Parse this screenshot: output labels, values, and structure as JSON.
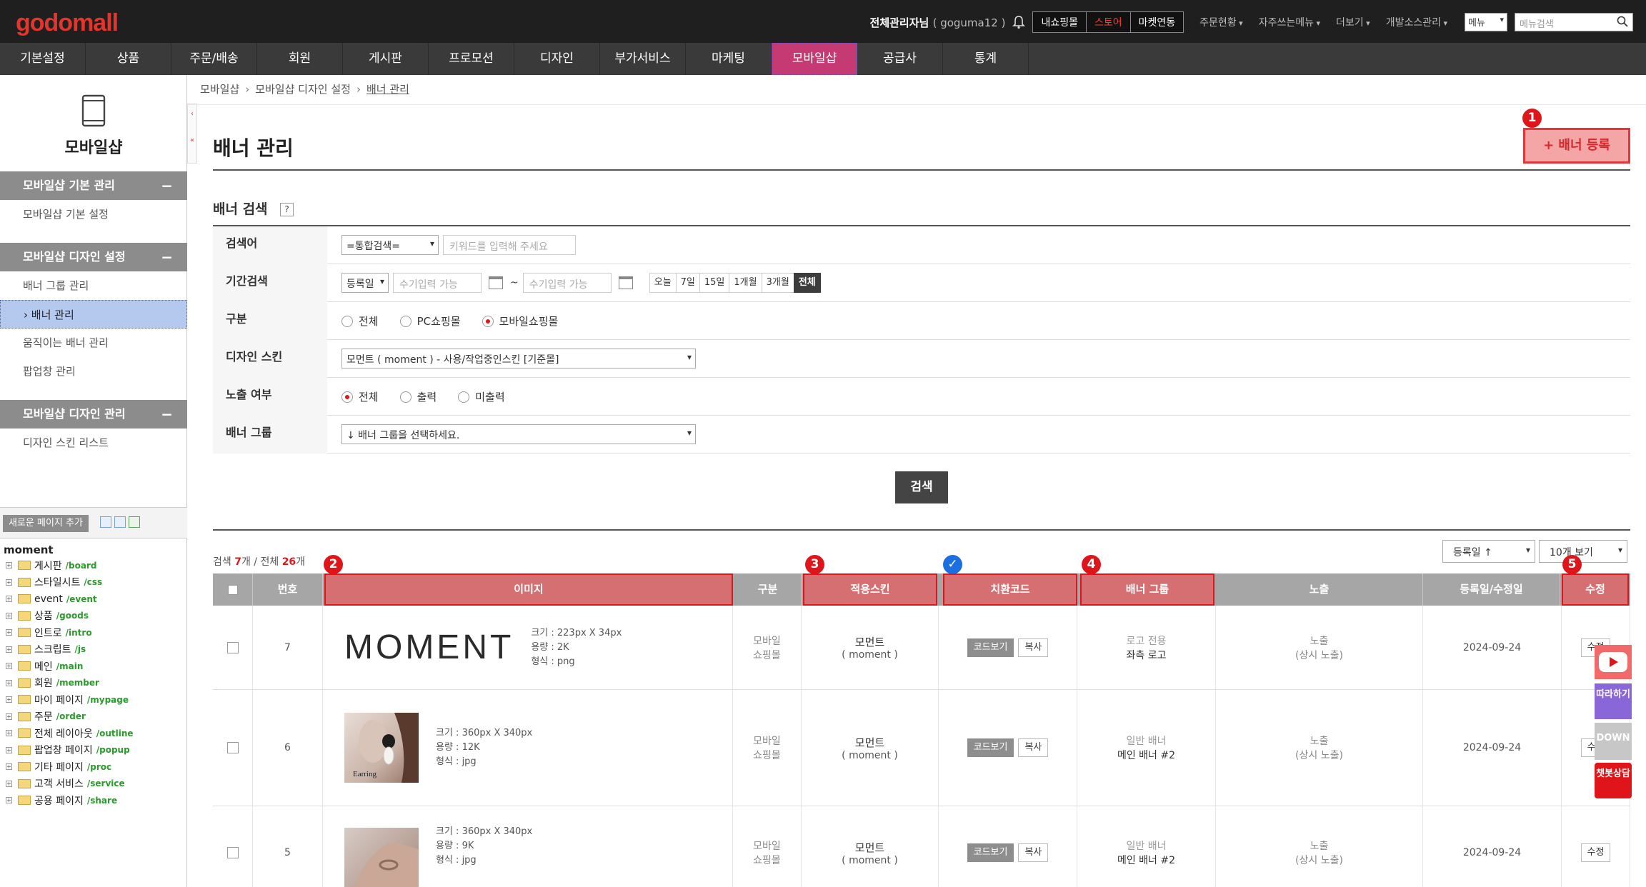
{
  "topbar": {
    "logo": "godomall",
    "admin_label": "전체관리자님",
    "admin_id": "( goguma12 )",
    "buttons": [
      "내쇼핑몰",
      "스토어",
      "마켓연동"
    ],
    "menus": [
      "주문현황",
      "자주쓰는메뉴",
      "더보기",
      "개발소스관리"
    ],
    "menu_select": "메뉴",
    "search_placeholder": "메뉴검색"
  },
  "mainnav": {
    "items": [
      "기본설정",
      "상품",
      "주문/배송",
      "회원",
      "게시판",
      "프로모션",
      "디자인",
      "부가서비스",
      "마케팅",
      "모바일샵",
      "공급사",
      "통계"
    ],
    "active": "모바일샵"
  },
  "sidebar": {
    "title": "모바일샵",
    "groups": [
      {
        "label": "모바일샵 기본 관리",
        "links": [
          "모바일샵 기본 설정"
        ]
      },
      {
        "label": "모바일샵 디자인 설정",
        "links": [
          "배너 그룹 관리",
          "배너 관리",
          "움직이는 배너 관리",
          "팝업창 관리"
        ]
      },
      {
        "label": "모바일샵 디자인 관리",
        "links": [
          "디자인 스킨 리스트"
        ]
      }
    ],
    "active_link": "배너 관리",
    "new_page_button": "새로운 페이지 추가",
    "tree_root": "moment",
    "tree": [
      {
        "name": "게시판",
        "path": "/board"
      },
      {
        "name": "스타일시트",
        "path": "/css"
      },
      {
        "name": "event",
        "path": "/event"
      },
      {
        "name": "상품",
        "path": "/goods"
      },
      {
        "name": "인트로",
        "path": "/intro"
      },
      {
        "name": "스크립트",
        "path": "/js"
      },
      {
        "name": "메인",
        "path": "/main"
      },
      {
        "name": "회원",
        "path": "/member"
      },
      {
        "name": "마이 페이지",
        "path": "/mypage"
      },
      {
        "name": "주문",
        "path": "/order"
      },
      {
        "name": "전체 레이아웃",
        "path": "/outline"
      },
      {
        "name": "팝업창 페이지",
        "path": "/popup"
      },
      {
        "name": "기타 페이지",
        "path": "/proc"
      },
      {
        "name": "고객 서비스",
        "path": "/service"
      },
      {
        "name": "공용 페이지",
        "path": "/share"
      }
    ]
  },
  "breadcrumb": [
    "모바일샵",
    "모바일샵 디자인 설정",
    "배너 관리"
  ],
  "page": {
    "title": "배너 관리",
    "add_button": "+ 배너 등록",
    "search_section": "배너 검색",
    "help": "?"
  },
  "form": {
    "keyword": {
      "label": "검색어",
      "select": "=통합검색=",
      "placeholder": "키워드를 입력해 주세요"
    },
    "period": {
      "label": "기간검색",
      "select": "등록일",
      "from_placeholder": "수기입력 가능",
      "to_placeholder": "수기입력 가능",
      "tilde": "~",
      "buttons": [
        "오늘",
        "7일",
        "15일",
        "1개월",
        "3개월",
        "전체"
      ],
      "active": "전체"
    },
    "type": {
      "label": "구분",
      "options": [
        "전체",
        "PC쇼핑몰",
        "모바일쇼핑몰"
      ],
      "selected": "모바일쇼핑몰"
    },
    "skin": {
      "label": "디자인 스킨",
      "select": "모먼트 ( moment ) - 사용/작업중인스킨 [기준몰]"
    },
    "display": {
      "label": "노출 여부",
      "options": [
        "전체",
        "출력",
        "미출력"
      ],
      "selected": "전체"
    },
    "group": {
      "label": "배너 그룹",
      "select": "↓ 배너 그룹을 선택하세요."
    },
    "search_button": "검색"
  },
  "results": {
    "prefix": "검색",
    "found": "7",
    "found_suffix": "개 / 전체",
    "total": "26",
    "total_suffix": "개",
    "sort": "등록일 ↑",
    "per_page": "10개 보기"
  },
  "badges": [
    "1",
    "2",
    "3",
    "✓",
    "4",
    "5"
  ],
  "table": {
    "headers": [
      "",
      "번호",
      "이미지",
      "구분",
      "적용스킨",
      "치환코드",
      "배너 그룹",
      "노출",
      "등록일/수정일",
      "수정"
    ],
    "rows": [
      {
        "no": "7",
        "image_text": "MOMENT",
        "size": "크기 : 223px X 34px",
        "volume": "용량 : 2K",
        "format": "형식 : png",
        "type1": "모바일",
        "type2": "쇼핑몰",
        "skin1": "모먼트",
        "skin2": "( moment )",
        "code_view": "코드보기",
        "copy": "복사",
        "group_type": "로고 전용",
        "group_name": "좌측 로고",
        "display1": "노출",
        "display2": "(상시 노출)",
        "date": "2024-09-24",
        "edit": "수정"
      },
      {
        "no": "6",
        "image_label": "Earring",
        "size": "크기 : 360px X 340px",
        "volume": "용량 : 12K",
        "format": "형식 : jpg",
        "type1": "모바일",
        "type2": "쇼핑몰",
        "skin1": "모먼트",
        "skin2": "( moment )",
        "code_view": "코드보기",
        "copy": "복사",
        "group_type": "일반 배너",
        "group_name": "메인 배너 #2",
        "display1": "노출",
        "display2": "(상시 노출)",
        "date": "2024-09-24",
        "edit": "수정"
      },
      {
        "no": "5",
        "size": "크기 : 360px X 340px",
        "volume": "용량 : 9K",
        "format": "형식 : jpg",
        "type1": "모바일",
        "type2": "쇼핑몰",
        "skin1": "모먼트",
        "skin2": "( moment )",
        "code_view": "코드보기",
        "copy": "복사",
        "group_type": "일반 배너",
        "group_name": "메인 배너 #2",
        "display1": "노출",
        "display2": "(상시 노출)",
        "date": "2024-09-24",
        "edit": "수정"
      }
    ]
  },
  "floating": {
    "follow": "따라하기",
    "down": "DOWN",
    "chat": "챗봇상담",
    "youtube_icon": "youtube-play-icon"
  },
  "colors": {
    "accent": "#e0151a",
    "active_nav": "#c53a72",
    "header_bg": "#a6a6a6",
    "highlight_header": "#d66f71"
  }
}
